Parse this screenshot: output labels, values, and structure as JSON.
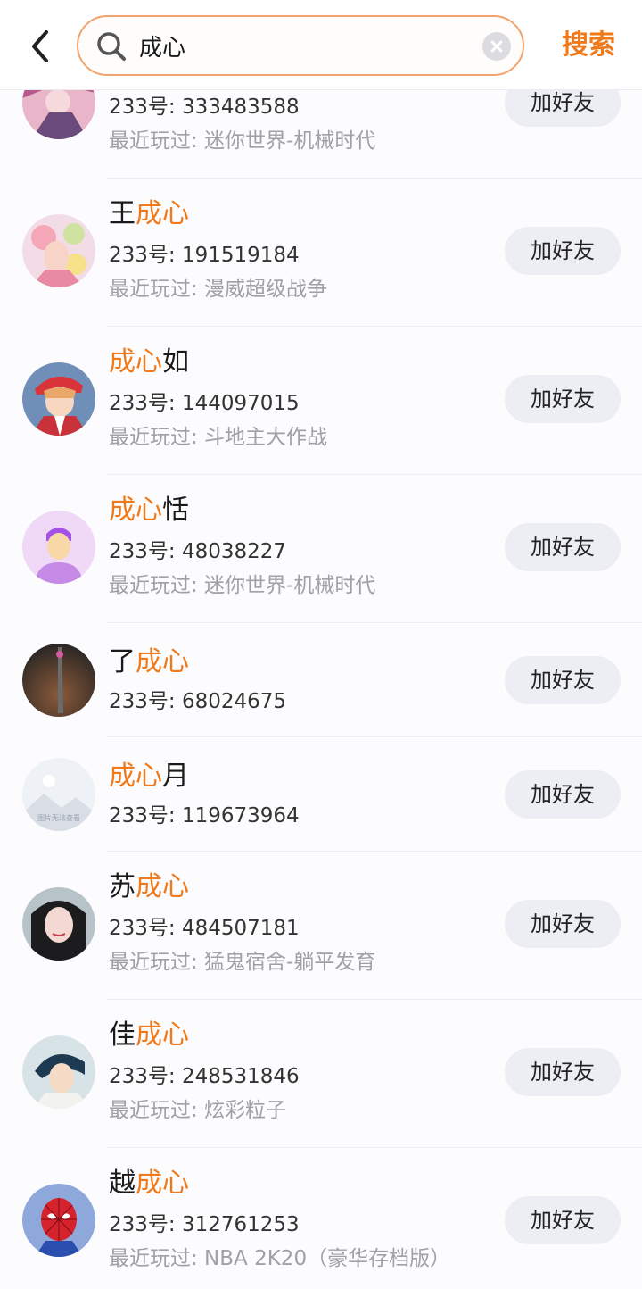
{
  "search": {
    "query": "成心",
    "action_label": "搜索"
  },
  "results": [
    {
      "name_prefix": "",
      "name_match": "",
      "name_suffix": "",
      "id_text": "233号: 333483588",
      "recent_text": "最近玩过: 迷你世界-机械时代",
      "button_label": "加好友"
    },
    {
      "name_prefix": "王",
      "name_match": "成心",
      "name_suffix": "",
      "id_text": "233号: 191519184",
      "recent_text": "最近玩过: 漫威超级战争",
      "button_label": "加好友"
    },
    {
      "name_prefix": "",
      "name_match": "成心",
      "name_suffix": "如",
      "id_text": "233号: 144097015",
      "recent_text": "最近玩过: 斗地主大作战",
      "button_label": "加好友"
    },
    {
      "name_prefix": "",
      "name_match": "成心",
      "name_suffix": "恬",
      "id_text": "233号: 48038227",
      "recent_text": "最近玩过: 迷你世界-机械时代",
      "button_label": "加好友"
    },
    {
      "name_prefix": "了",
      "name_match": "成心",
      "name_suffix": "",
      "id_text": "233号: 68024675",
      "recent_text": "",
      "button_label": "加好友"
    },
    {
      "name_prefix": "",
      "name_match": "成心",
      "name_suffix": "月",
      "id_text": "233号: 119673964",
      "recent_text": "",
      "button_label": "加好友"
    },
    {
      "name_prefix": "苏",
      "name_match": "成心",
      "name_suffix": "",
      "id_text": "233号: 484507181",
      "recent_text": "最近玩过: 猛鬼宿舍-躺平发育",
      "button_label": "加好友"
    },
    {
      "name_prefix": "佳",
      "name_match": "成心",
      "name_suffix": "",
      "id_text": "233号: 248531846",
      "recent_text": "最近玩过: 炫彩粒子",
      "button_label": "加好友"
    },
    {
      "name_prefix": "越",
      "name_match": "成心",
      "name_suffix": "",
      "id_text": "233号: 312761253",
      "recent_text": "最近玩过: NBA 2K20（豪华存档版）",
      "button_label": "加好友"
    }
  ],
  "avatar_placeholder_text": "图片无法查看",
  "colors": {
    "accent": "#f07a1a",
    "search_border": "#f0a36c",
    "button_bg": "#eceef4",
    "secondary_text": "#a0a0a6"
  }
}
